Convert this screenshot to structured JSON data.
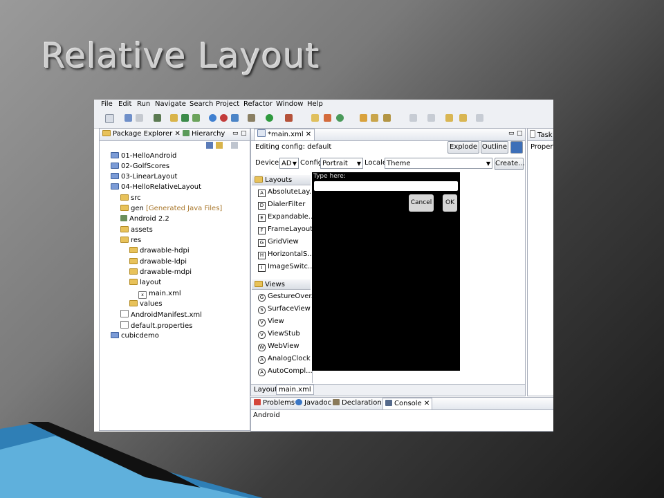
{
  "slide": {
    "title": "Relative Layout"
  },
  "menu": [
    "File",
    "Edit",
    "Run",
    "Navigate",
    "Search",
    "Project",
    "Refactor",
    "Window",
    "Help"
  ],
  "explorer": {
    "tab_package": "Package Explorer",
    "tab_hierarchy": "Hierarchy",
    "tree": [
      {
        "label": "01-HelloAndroid",
        "type": "project"
      },
      {
        "label": "02-GolfScores",
        "type": "project"
      },
      {
        "label": "03-LinearLayout",
        "type": "project"
      },
      {
        "label": "04-HelloRelativeLayout",
        "type": "project"
      },
      {
        "label": "src",
        "type": "folder"
      },
      {
        "label": "gen",
        "extra": "[Generated Java Files]",
        "type": "folder"
      },
      {
        "label": "Android 2.2",
        "type": "lib"
      },
      {
        "label": "assets",
        "type": "folder"
      },
      {
        "label": "res",
        "type": "folder"
      },
      {
        "label": "drawable-hdpi",
        "type": "folder"
      },
      {
        "label": "drawable-ldpi",
        "type": "folder"
      },
      {
        "label": "drawable-mdpi",
        "type": "folder"
      },
      {
        "label": "layout",
        "type": "folder"
      },
      {
        "label": "main.xml",
        "type": "file"
      },
      {
        "label": "values",
        "type": "folder"
      },
      {
        "label": "AndroidManifest.xml",
        "type": "file"
      },
      {
        "label": "default.properties",
        "type": "file"
      },
      {
        "label": "cubicdemo",
        "type": "project"
      }
    ]
  },
  "editor": {
    "tab": "*main.xml",
    "config_label": "Editing config: default",
    "explode": "Explode",
    "outline": "Outline",
    "devices_label": "Devices",
    "devices_value": "AD",
    "config_word": "Config",
    "config_value": "Portrait",
    "locale_label": "Locale",
    "theme_value": "Theme",
    "create": "Create...",
    "bottom_tabs": [
      "Layout",
      "main.xml"
    ]
  },
  "palette": {
    "layouts_header": "Layouts",
    "layouts": [
      {
        "letter": "A",
        "label": "AbsoluteLay..."
      },
      {
        "letter": "D",
        "label": "DialerFilter"
      },
      {
        "letter": "E",
        "label": "Expandable..."
      },
      {
        "letter": "F",
        "label": "FrameLayout"
      },
      {
        "letter": "G",
        "label": "GridView"
      },
      {
        "letter": "H",
        "label": "HorizontalS..."
      },
      {
        "letter": "I",
        "label": "ImageSwitc..."
      }
    ],
    "views_header": "Views",
    "views": [
      {
        "letter": "G",
        "label": "GestureOver..."
      },
      {
        "letter": "S",
        "label": "SurfaceView"
      },
      {
        "letter": "V",
        "label": "View"
      },
      {
        "letter": "V",
        "label": "ViewStub"
      },
      {
        "letter": "W",
        "label": "WebView"
      },
      {
        "letter": "A",
        "label": "AnalogClock"
      },
      {
        "letter": "A",
        "label": "AutoCompl..."
      }
    ]
  },
  "preview": {
    "label": "Type here:",
    "cancel": "Cancel",
    "ok": "OK"
  },
  "right_panel": {
    "tab": "Task",
    "row": "Propert"
  },
  "bottom": {
    "tabs": [
      "Problems",
      "Javadoc",
      "Declaration",
      "Console"
    ],
    "console_text": "Android"
  }
}
